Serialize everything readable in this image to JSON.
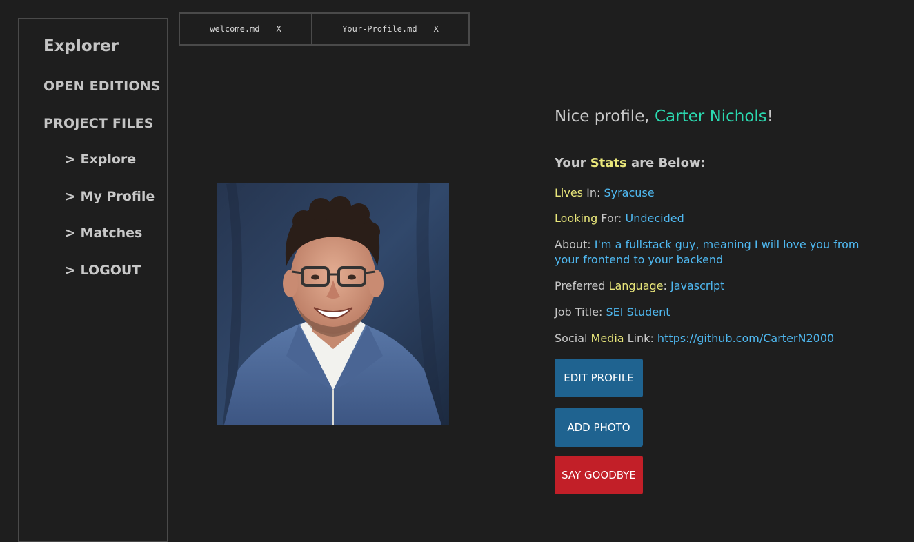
{
  "sidebar": {
    "title": "Explorer",
    "open_editions": "OPEN EDITIONS",
    "project_files": "PROJECT FILES",
    "items": [
      {
        "label": "> Explore"
      },
      {
        "label": "> My Profile"
      },
      {
        "label": "> Matches"
      },
      {
        "label": "> LOGOUT"
      }
    ]
  },
  "tabs": [
    {
      "label": "welcome.md",
      "close": "X"
    },
    {
      "label": "Your-Profile.md",
      "close": "X"
    }
  ],
  "profile": {
    "greeting_prefix": "Nice profile, ",
    "name": "Carter Nichols",
    "greeting_suffix": "!",
    "stats_prefix": "Your ",
    "stats_highlight": "Stats",
    "stats_suffix": " are Below:",
    "lives": {
      "highlight": "Lives",
      "label": " In: ",
      "value": "Syracuse"
    },
    "looking": {
      "highlight": "Looking",
      "label": " For: ",
      "value": "Undecided"
    },
    "about": {
      "label": "About: ",
      "value": "I'm a fullstack guy, meaning I will love you from your frontend to your backend"
    },
    "language": {
      "label": "Preferred ",
      "highlight": "Language",
      "sep": ": ",
      "value": "Javascript"
    },
    "job": {
      "label": "Job Title: ",
      "value": "SEI Student"
    },
    "social": {
      "label": "Social ",
      "highlight": "Media",
      "suffix": " Link: ",
      "value": "https://github.com/CarterN2000"
    }
  },
  "buttons": {
    "edit": "EDIT PROFILE",
    "add_photo": "ADD PHOTO",
    "goodbye": "SAY GOODBYE"
  },
  "colors": {
    "background": "#1e1e1e",
    "name_accent": "#2bd9b0",
    "highlight": "#e8e67a",
    "value": "#4fb8f0",
    "button_blue": "#1f6390",
    "button_red": "#c21f28"
  }
}
